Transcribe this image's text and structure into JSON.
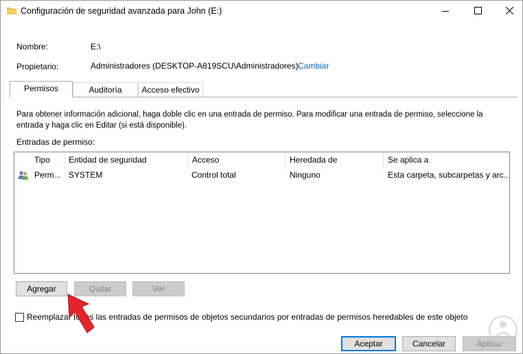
{
  "window": {
    "title": "Configuración de seguridad avanzada para John (E:)"
  },
  "info": {
    "name_label": "Nombre:",
    "name_value": "E:\\",
    "owner_label": "Propietario:",
    "owner_value": "Administradores (DESKTOP-A819SCU\\Administradores)",
    "change_link": "Cambiar"
  },
  "tabs": [
    {
      "label": "Permisos",
      "active": true
    },
    {
      "label": "Auditoría",
      "active": false
    },
    {
      "label": "Acceso efectivo",
      "active": false
    }
  ],
  "description": "Para obtener información adicional, haga doble clic en una entrada de permiso. Para modificar una entrada de permiso, seleccione la entrada y haga clic en Editar (si está disponible).",
  "entries_label": "Entradas de permiso:",
  "table": {
    "columns": [
      "Tipo",
      "Entidad de seguridad",
      "Acceso",
      "Heredada de",
      "Se aplica a"
    ],
    "rows": [
      [
        "Perm...",
        "SYSTEM",
        "Control total",
        "Ninguno",
        "Esta carpeta, subcarpetas y arc..."
      ]
    ]
  },
  "actions": {
    "add": "Agregar",
    "remove": "Quitar",
    "view": "Ver"
  },
  "replace_checkbox": {
    "label": "Reemplazar todas las entradas de permisos de objetos secundarios por entradas de permisos heredables de este objeto",
    "checked": false
  },
  "footer": {
    "ok": "Aceptar",
    "cancel": "Cancelar",
    "apply": "Aplicar"
  },
  "colors": {
    "link": "#0a64b4",
    "default_button_border": "#0078d7",
    "annotation_arrow": "#e8222a"
  },
  "icons": {
    "title": "folder-icon",
    "row": "users-icon",
    "minimize": "minimize-icon",
    "maximize": "maximize-icon",
    "close": "close-icon"
  }
}
